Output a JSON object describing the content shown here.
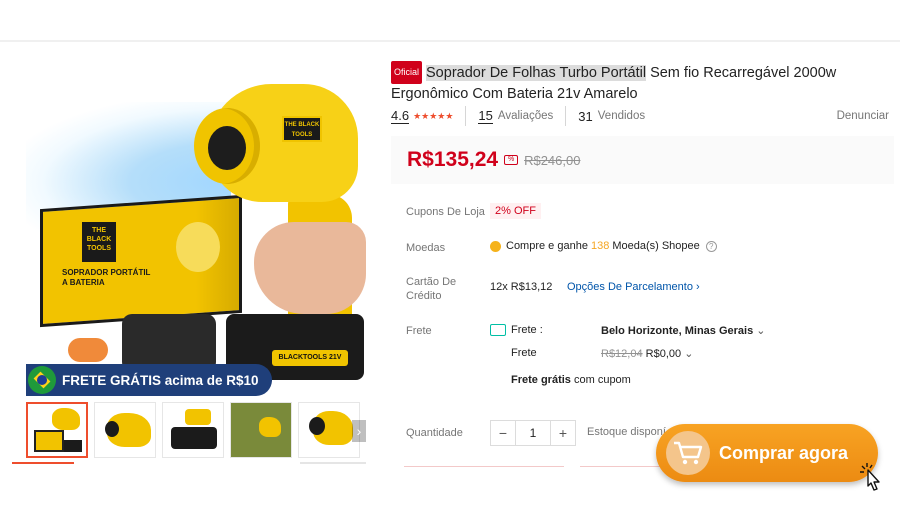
{
  "product": {
    "official_badge": "Oficial",
    "title_highlight": "Soprador De Folhas Turbo Portátil",
    "title_rest": " Sem fio Recarregável 2000w Ergonômico Com Bateria 21v Amarelo",
    "rating": "4.6",
    "reviews_count": "15",
    "reviews_label": "Avaliações",
    "sold_count": "31",
    "sold_label": "Vendidos",
    "report_label": "Denunciar",
    "price": "R$135,24",
    "old_price": "R$246,00"
  },
  "image": {
    "banner_text": "FRETE GRÁTIS acima de R$10",
    "head_badge": "THE BLACK TOOLS",
    "box_logo": "THE BLACK TOOLS",
    "box_title": "SOPRADOR PORTÁTIL A BATERIA",
    "battery_label": "BLACKTOOLS 21V",
    "thumbnail_count": 5
  },
  "details": {
    "coupons_label": "Cupons De Loja",
    "coupon_value": "2% OFF",
    "coins_label": "Moedas",
    "coins_prefix": "Compre e ganhe",
    "coins_amount": "138",
    "coins_suffix": "Moeda(s) Shopee",
    "card_label": "Cartão De Crédito",
    "installments": "12x R$13,12",
    "installment_options": "Opções De Parcelamento",
    "shipping_label": "Frete",
    "shipping_to_label": "Frete :",
    "shipping_city": "Belo Horizonte, Minas Gerais",
    "shipping_fee_label": "Frete",
    "shipping_old_fee": "R$12,04",
    "shipping_fee": "R$0,00",
    "free_shipping_bold": "Frete grátis",
    "free_shipping_rest": "com cupom",
    "quantity_label": "Quantidade",
    "quantity_value": "1",
    "minus": "−",
    "plus": "+",
    "stock_text": "Estoque disponí"
  },
  "cta": {
    "buy_label": "Comprar agora"
  },
  "colors": {
    "accent": "#ee4d2d",
    "price_red": "#d0011b",
    "button_orange": "#f29a1c",
    "product_yellow": "#f2c300"
  }
}
